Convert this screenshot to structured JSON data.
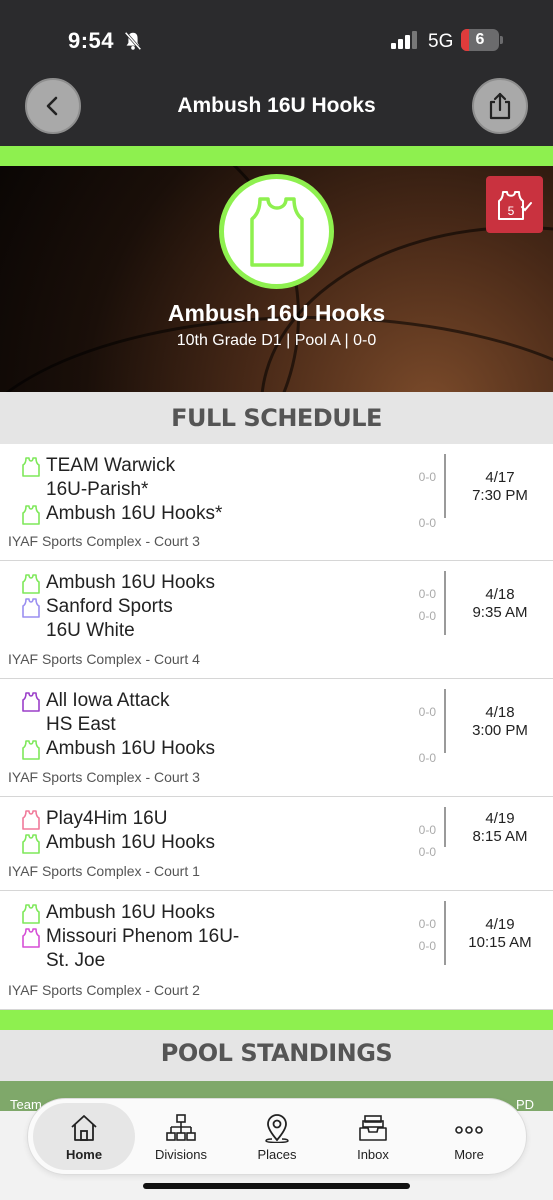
{
  "status_bar": {
    "time": "9:54",
    "network": "5G",
    "battery": "6"
  },
  "nav": {
    "title": "Ambush 16U Hooks"
  },
  "hero": {
    "team_name": "Ambush 16U Hooks",
    "subtitle": "10th Grade D1 | Pool A | 0-0",
    "badge_number": "5"
  },
  "schedule": {
    "header": "FULL SCHEDULE",
    "games": [
      {
        "teams": [
          {
            "name": "TEAM Warwick\n16U-Parish*",
            "score": "0-0",
            "jersey_color": "#7ee85a"
          },
          {
            "name": "Ambush 16U Hooks*",
            "score": "0-0",
            "jersey_color": "#7ee85a"
          }
        ],
        "date": "4/17",
        "time": "7:30 PM",
        "location": "IYAF Sports Complex - Court 3"
      },
      {
        "teams": [
          {
            "name": "Ambush 16U Hooks",
            "score": "0-0",
            "jersey_color": "#7ee85a"
          },
          {
            "name": "Sanford Sports\n16U White",
            "score": "0-0",
            "jersey_color": "#9b8ff0"
          }
        ],
        "date": "4/18",
        "time": "9:35 AM",
        "location": "IYAF Sports Complex - Court 4"
      },
      {
        "teams": [
          {
            "name": "All Iowa Attack\nHS East",
            "score": "0-0",
            "jersey_color": "#9b3fc9"
          },
          {
            "name": "Ambush 16U Hooks",
            "score": "0-0",
            "jersey_color": "#7ee85a"
          }
        ],
        "date": "4/18",
        "time": "3:00 PM",
        "location": "IYAF Sports Complex - Court 3"
      },
      {
        "teams": [
          {
            "name": "Play4Him 16U",
            "score": "0-0",
            "jersey_color": "#f07a9a"
          },
          {
            "name": "Ambush 16U Hooks",
            "score": "0-0",
            "jersey_color": "#7ee85a"
          }
        ],
        "date": "4/19",
        "time": "8:15 AM",
        "location": "IYAF Sports Complex - Court 1"
      },
      {
        "teams": [
          {
            "name": "Ambush 16U Hooks",
            "score": "0-0",
            "jersey_color": "#7ee85a"
          },
          {
            "name": "Missouri Phenom 16U-\nSt. Joe",
            "score": "0-0",
            "jersey_color": "#d64fd6"
          }
        ],
        "date": "4/19",
        "time": "10:15 AM",
        "location": "IYAF Sports Complex - Court 2"
      }
    ]
  },
  "standings": {
    "header": "POOL STANDINGS",
    "col_team": "Team",
    "col_pd": "PD"
  },
  "tabs": [
    {
      "label": "Home",
      "icon": "home-icon"
    },
    {
      "label": "Divisions",
      "icon": "divisions-icon"
    },
    {
      "label": "Places",
      "icon": "map-pin-icon"
    },
    {
      "label": "Inbox",
      "icon": "inbox-icon"
    },
    {
      "label": "More",
      "icon": "more-icon"
    }
  ],
  "colors": {
    "accent_green": "#8ef04f",
    "top_bar": "#2b2b2d",
    "badge_red": "#c9323f"
  }
}
